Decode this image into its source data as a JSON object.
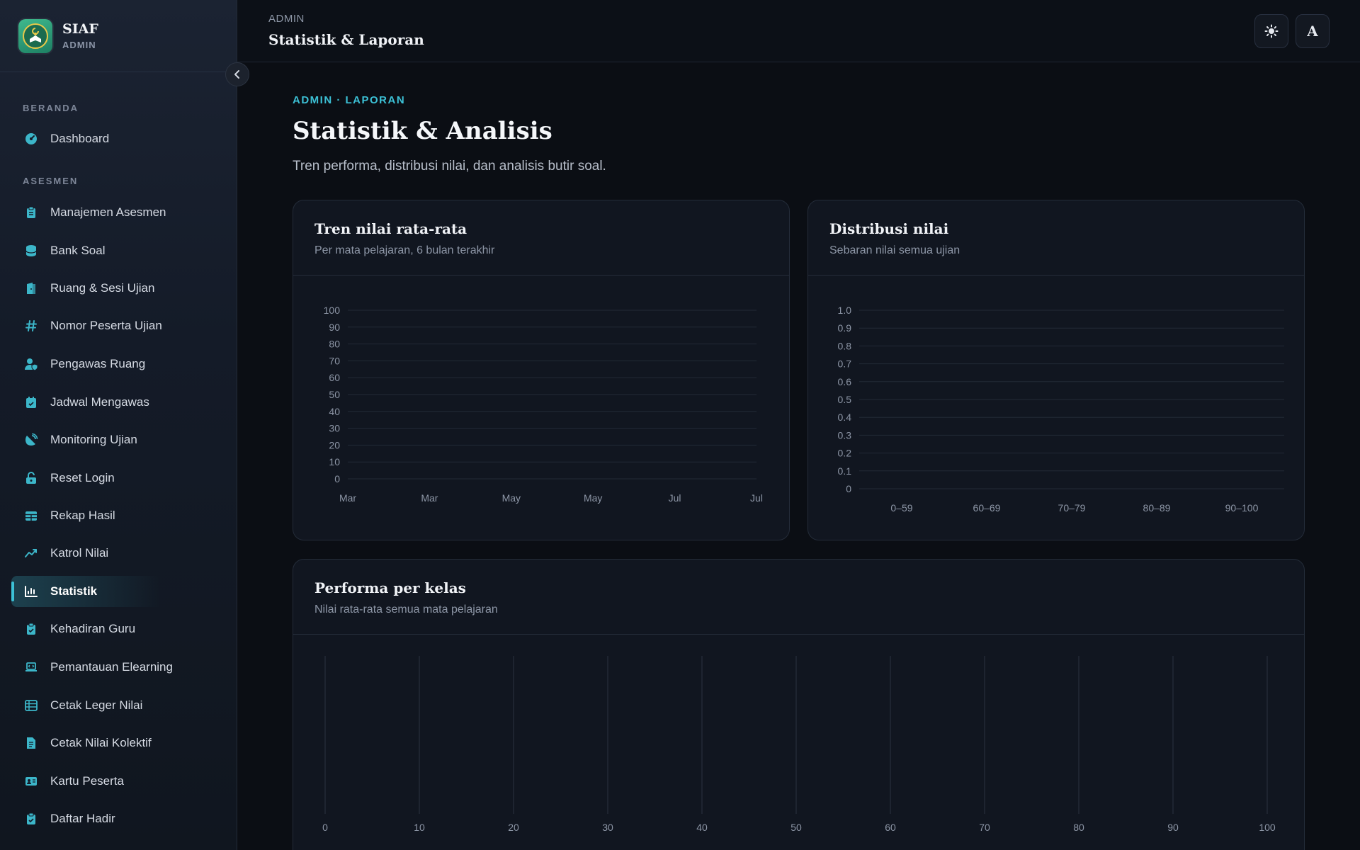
{
  "brand": {
    "name": "SIAF",
    "role": "ADMIN"
  },
  "sidebar": {
    "sections": [
      {
        "label": "BERANDA"
      },
      {
        "label": "ASESMEN"
      }
    ],
    "items": [
      {
        "label": "Dashboard",
        "icon": "gauge-icon"
      },
      {
        "label": "Manajemen Asesmen",
        "icon": "clipboard-icon"
      },
      {
        "label": "Bank Soal",
        "icon": "database-icon"
      },
      {
        "label": "Ruang & Sesi Ujian",
        "icon": "door-icon"
      },
      {
        "label": "Nomor Peserta Ujian",
        "icon": "hash-icon"
      },
      {
        "label": "Pengawas Ruang",
        "icon": "user-shield-icon"
      },
      {
        "label": "Jadwal Mengawas",
        "icon": "calendar-check-icon"
      },
      {
        "label": "Monitoring Ujian",
        "icon": "satellite-icon"
      },
      {
        "label": "Reset Login",
        "icon": "unlock-icon"
      },
      {
        "label": "Rekap Hasil",
        "icon": "table-icon"
      },
      {
        "label": "Katrol Nilai",
        "icon": "trend-up-icon"
      },
      {
        "label": "Statistik",
        "icon": "bar-chart-icon",
        "active": true
      },
      {
        "label": "Kehadiran Guru",
        "icon": "clipboard-check-icon"
      },
      {
        "label": "Pemantauan Elearning",
        "icon": "laptop-code-icon"
      },
      {
        "label": "Cetak Leger Nilai",
        "icon": "list-table-icon"
      },
      {
        "label": "Cetak Nilai Kolektif",
        "icon": "file-text-icon"
      },
      {
        "label": "Kartu Peserta",
        "icon": "id-card-icon"
      },
      {
        "label": "Daftar Hadir",
        "icon": "clipboard-check-icon"
      }
    ]
  },
  "header": {
    "breadcrumb": "ADMIN",
    "title": "Statistik & Laporan",
    "theme_icon": "sun-icon",
    "avatar_letter": "A"
  },
  "page": {
    "eyebrow": "ADMIN · LAPORAN",
    "title": "Statistik & Analisis",
    "subtitle": "Tren performa, distribusi nilai, dan analisis butir soal."
  },
  "colors": {
    "accent": "#3cc1d6",
    "background": "#0b0e14",
    "card": "#111620"
  },
  "cards": {
    "trend": {
      "title": "Tren nilai rata-rata",
      "subtitle": "Per mata pelajaran, 6 bulan terakhir"
    },
    "distribution": {
      "title": "Distribusi nilai",
      "subtitle": "Sebaran nilai semua ujian"
    },
    "class": {
      "title": "Performa per kelas",
      "subtitle": "Nilai rata-rata semua mata pelajaran"
    }
  },
  "chart_data": [
    {
      "type": "line",
      "title": "Tren nilai rata-rata",
      "subtitle": "Per mata pelajaran, 6 bulan terakhir",
      "x": [
        "Mar",
        "Mar",
        "May",
        "May",
        "Jul",
        "Jul"
      ],
      "yticks": [
        "0",
        "10",
        "20",
        "30",
        "40",
        "50",
        "60",
        "70",
        "80",
        "90",
        "100"
      ],
      "ylim": [
        0,
        100
      ],
      "series": [],
      "grid": true
    },
    {
      "type": "bar",
      "title": "Distribusi nilai",
      "subtitle": "Sebaran nilai semua ujian",
      "categories": [
        "0–59",
        "60–69",
        "70–79",
        "80–89",
        "90–100"
      ],
      "yticks": [
        "0",
        "0.1",
        "0.2",
        "0.3",
        "0.4",
        "0.5",
        "0.6",
        "0.7",
        "0.8",
        "0.9",
        "1.0"
      ],
      "ylim": [
        0,
        1
      ],
      "values": [],
      "grid": true
    },
    {
      "type": "bar",
      "title": "Performa per kelas",
      "subtitle": "Nilai rata-rata semua mata pelajaran",
      "orientation": "horizontal",
      "xticks": [
        "0",
        "10",
        "20",
        "30",
        "40",
        "50",
        "60",
        "70",
        "80",
        "90",
        "100"
      ],
      "xlim": [
        0,
        100
      ],
      "values": [],
      "grid": true
    }
  ]
}
